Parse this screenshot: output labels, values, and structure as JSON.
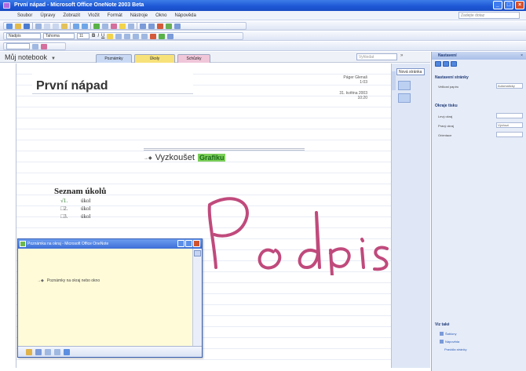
{
  "window": {
    "title": "První nápad - Microsoft Office OneNote 2003 Beta"
  },
  "menubar": {
    "items": [
      "Soubor",
      "Úpravy",
      "Zobrazit",
      "Vložit",
      "Formát",
      "Nástroje",
      "Okno",
      "Nápověda"
    ],
    "help_placeholder": "Zadejte dotaz"
  },
  "toolbar_format": {
    "style": "Nadpis",
    "font": "Tahoma",
    "size": "11"
  },
  "tabrow": {
    "notebook": "Můj notebook",
    "tabs": [
      "Poznámky",
      "Úkoly",
      "Schůzky"
    ],
    "find_placeholder": "Vyhledat",
    "find_btn": "»"
  },
  "page": {
    "title": "První nápad",
    "meta_line1": "Páger Glenaš",
    "meta_line2": "1:03",
    "meta_line3": "31. května 2003",
    "meta_line4": "10:20",
    "outline_text": "Vyzkoušet",
    "outline_highlight": "Grafiku"
  },
  "todo": {
    "title": "Seznam úkolů",
    "items": [
      {
        "num": "√1.",
        "label": "úkol",
        "done": true
      },
      {
        "num": "□2.",
        "label": "úkol",
        "done": false
      },
      {
        "num": "□3.",
        "label": "úkol",
        "done": false
      }
    ]
  },
  "ink_text": "Podpis",
  "sidenote": {
    "title": "Poznámka na okraj - Microsoft Office OneNote",
    "text": "Poznámky na okraj nebo okno"
  },
  "pagetabs": {
    "new_page": "Nová stránka"
  },
  "taskpane": {
    "title": "Nastavení",
    "close": "×",
    "section1": "Nastavení stránky",
    "row1": "Velikost papíru",
    "row1_value": "Automaticky",
    "section2": "Okraje tisku",
    "row2": "Levý okraj",
    "row3": "Pravý okraj",
    "row3_value": "Výchozí",
    "row4": "Orientace",
    "see_also": "Viz také",
    "link1": "Šablony",
    "link2": "Nápověda",
    "link3": "Pravidla stránky"
  },
  "colors": {
    "titlebar": "#1c56d4",
    "highlight": "#7bcf58",
    "ink": "#c04a7c",
    "note_bg": "#fffbd8"
  }
}
